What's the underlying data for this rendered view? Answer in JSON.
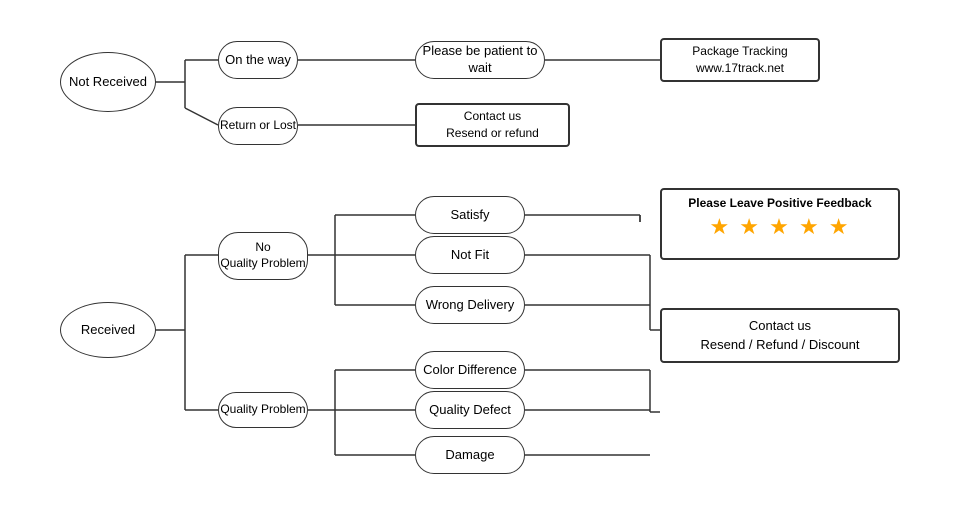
{
  "nodes": {
    "not_received": {
      "label": "Not\nReceived"
    },
    "on_the_way": {
      "label": "On the way"
    },
    "patient": {
      "label": "Please be patient to wait"
    },
    "package_tracking": {
      "label": "Package Tracking\nwww.17track.net"
    },
    "return_lost": {
      "label": "Return or Lost"
    },
    "contact_resend_refund": {
      "label": "Contact us\nResend or refund"
    },
    "received": {
      "label": "Received"
    },
    "no_quality": {
      "label": "No\nQuality Problem"
    },
    "quality_problem": {
      "label": "Quality Problem"
    },
    "satisfy": {
      "label": "Satisfy"
    },
    "not_fit": {
      "label": "Not Fit"
    },
    "wrong_delivery": {
      "label": "Wrong Delivery"
    },
    "color_diff": {
      "label": "Color Difference"
    },
    "quality_defect": {
      "label": "Quality Defect"
    },
    "damage": {
      "label": "Damage"
    },
    "feedback_title": {
      "label": "Please Leave Positive Feedback"
    },
    "contact_resend_refund_discount": {
      "label": "Contact us\nResend / Refund / Discount"
    }
  },
  "stars": "★ ★ ★ ★ ★"
}
